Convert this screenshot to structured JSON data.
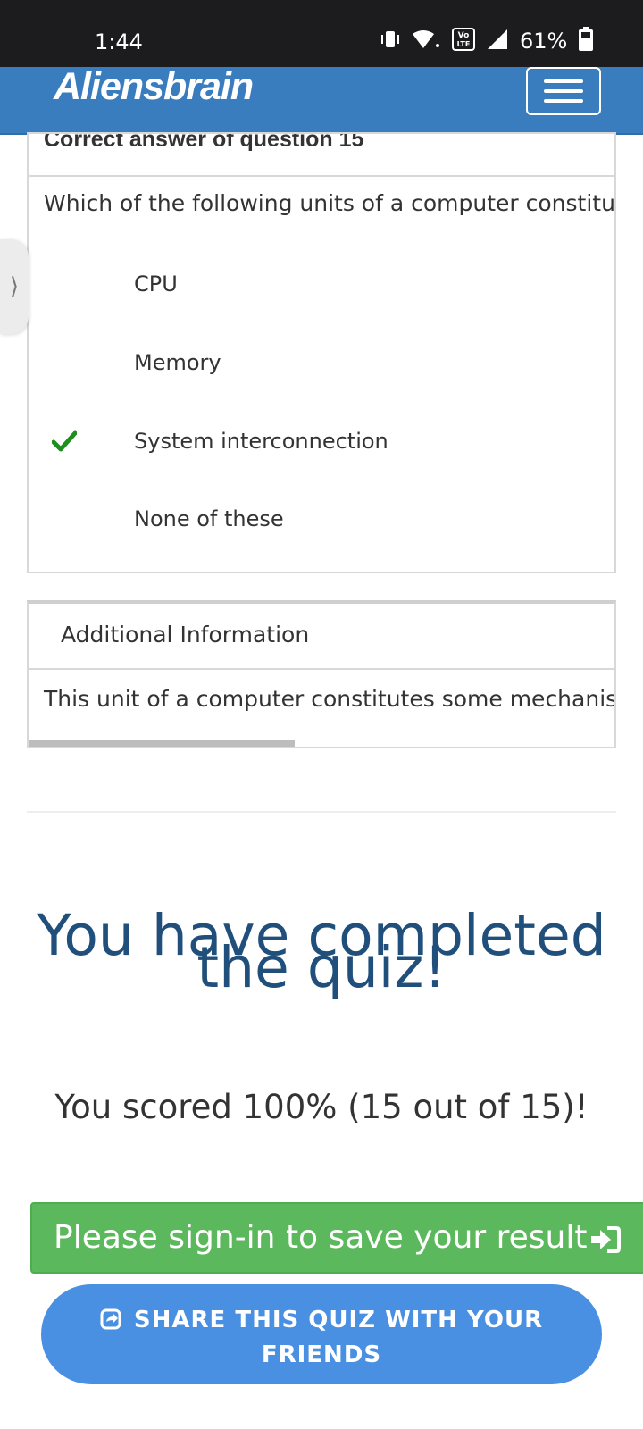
{
  "status_bar": {
    "time": "1:44",
    "battery": "61%",
    "network_badge": "Vo LTE"
  },
  "app_bar": {
    "brand": "Aliensbrain",
    "menu_icon": "hamburger-menu-icon",
    "color": "#3a7dbf"
  },
  "question_card": {
    "header": "Correct answer of question 15",
    "question": "Which of the following units of a computer constitute",
    "options": [
      {
        "label": "CPU",
        "correct": false
      },
      {
        "label": "Memory",
        "correct": false
      },
      {
        "label": "System interconnection",
        "correct": true
      },
      {
        "label": "None of these",
        "correct": false
      }
    ],
    "check_icon": "check-icon",
    "check_color": "#1e8e1e"
  },
  "info_card": {
    "header": "Additional Information",
    "body": "This unit of a computer constitutes some mechanism"
  },
  "result": {
    "title_line1": "You have completed",
    "title_line2": "the quiz!",
    "score": "You scored 100% (15 out of 15)!",
    "title_color": "#1f4f7a"
  },
  "signin": {
    "label": "Please sign-in to save your result",
    "icon": "sign-in-icon",
    "color": "#5cb85c"
  },
  "share": {
    "line1": "SHARE THIS QUIZ WITH YOUR",
    "line2": "FRIENDS",
    "icon": "share-icon",
    "color": "#4a90e2"
  }
}
